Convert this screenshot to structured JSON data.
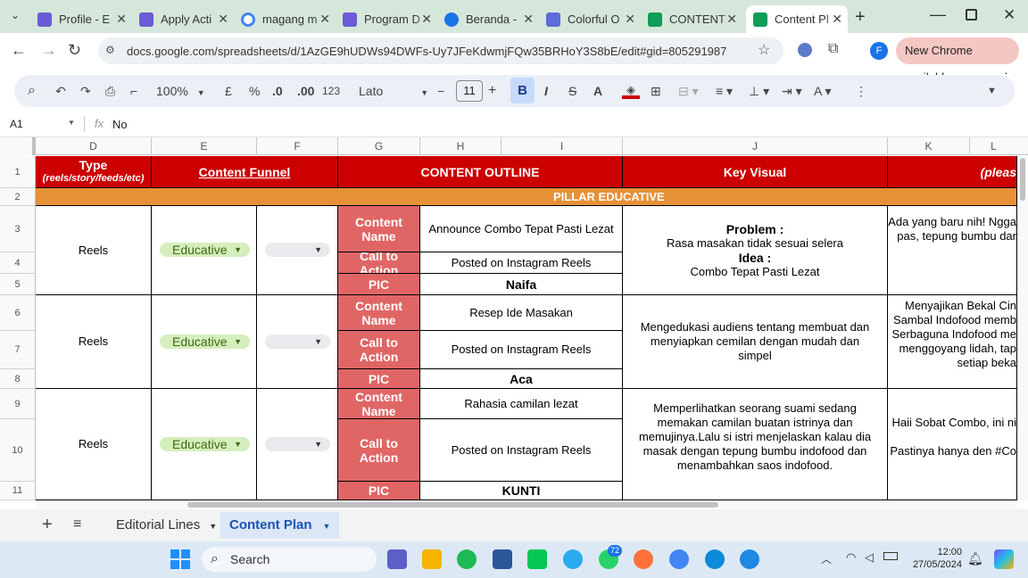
{
  "browser": {
    "tabs": [
      {
        "title": "Profile - E",
        "color": "#6b5bd6"
      },
      {
        "title": "Apply Acti",
        "color": "#6b5bd6"
      },
      {
        "title": "magang m",
        "color": "#4285f4"
      },
      {
        "title": "Program D",
        "color": "#6b5bd6"
      },
      {
        "title": "Beranda -",
        "color": "#1a73e8"
      },
      {
        "title": "Colorful O",
        "color": "#5f6bd8"
      },
      {
        "title": "CONTENT",
        "color": "#0f9d58"
      },
      {
        "title": "Content Pl",
        "color": "#0f9d58"
      }
    ],
    "url": "docs.google.com/spreadsheets/d/1AzGE9hUDWs94DWFs-Uy7JFeKdwmjFQw35BRHoY3S8bE/edit#gid=805291987",
    "update_label": "New Chrome available",
    "profile_initial": "F"
  },
  "toolbar": {
    "zoom": "100%",
    "currency": "£",
    "percent": "%",
    "dec_less": ".0",
    "dec_more": ".00",
    "format": "123",
    "font": "Lato",
    "font_size": "11",
    "bold": "B",
    "italic": "I",
    "strike": "S",
    "text_color": "A"
  },
  "formula": {
    "cell_ref": "A1",
    "fx": "fx",
    "value": "No"
  },
  "columns": [
    "D",
    "E",
    "F",
    "G",
    "H",
    "I",
    "J",
    "K",
    "L"
  ],
  "rows": [
    "1",
    "2",
    "3",
    "4",
    "5",
    "6",
    "7",
    "8",
    "9",
    "10",
    "11"
  ],
  "sheet": {
    "header": {
      "type": "Type",
      "type_sub": "(reels/story/feeds/etc)",
      "funnel": "Content Funnel",
      "outline": "CONTENT OUTLINE",
      "visual": "Key Visual",
      "l_partial": "(pleas"
    },
    "pillar": "PILLAR EDUCATIVE",
    "labels": {
      "content_name": "Content Name",
      "cta": "Call to Action",
      "pic": "PIC"
    },
    "blocks": [
      {
        "type": "Reels",
        "funnel": "Educative",
        "name": "Announce Combo Tepat Pasti Lezat",
        "cta": "Posted on Instagram Reels",
        "pic": "Naifa",
        "visual_l1": "Problem :",
        "visual_l2": "Rasa masakan tidak sesuai selera",
        "visual_l3": "Idea :",
        "visual_l4": "Combo Tepat Pasti Lezat",
        "k": "Ada yang baru nih! Ngga pas, tepung bumbu dar"
      },
      {
        "type": "Reels",
        "funnel": "Educative",
        "name": "Resep Ide Masakan",
        "cta": "Posted on Instagram Reels",
        "pic": "Aca",
        "visual": "Mengedukasi audiens tentang membuat dan menyiapkan cemilan dengan mudah dan simpel",
        "k": "Menyajikan Bekal Cin Sambal Indofood memb Serbaguna Indofood me menggoyang lidah, tap setiap beka"
      },
      {
        "type": "Reels",
        "funnel": "Educative",
        "name": "Rahasia camilan lezat",
        "cta": "Posted on Instagram Reels",
        "pic": "KUNTI",
        "visual": "Memperlihatkan seorang suami sedang memakan camilan buatan istrinya dan memujinya.Lalu si istri menjelaskan kalau dia masak dengan tepung bumbu indofood dan menambahkan saos indofood.",
        "k1": "Haii Sobat Combo, ini ni",
        "k2": "Pastinya hanya den #Co"
      }
    ]
  },
  "sheet_tabs": {
    "add": "+",
    "tab1": "Editorial Lines",
    "tab2": "Content Plan"
  },
  "taskbar": {
    "search": "Search",
    "badge": "72",
    "time": "12:00",
    "date": "27/05/2024"
  }
}
